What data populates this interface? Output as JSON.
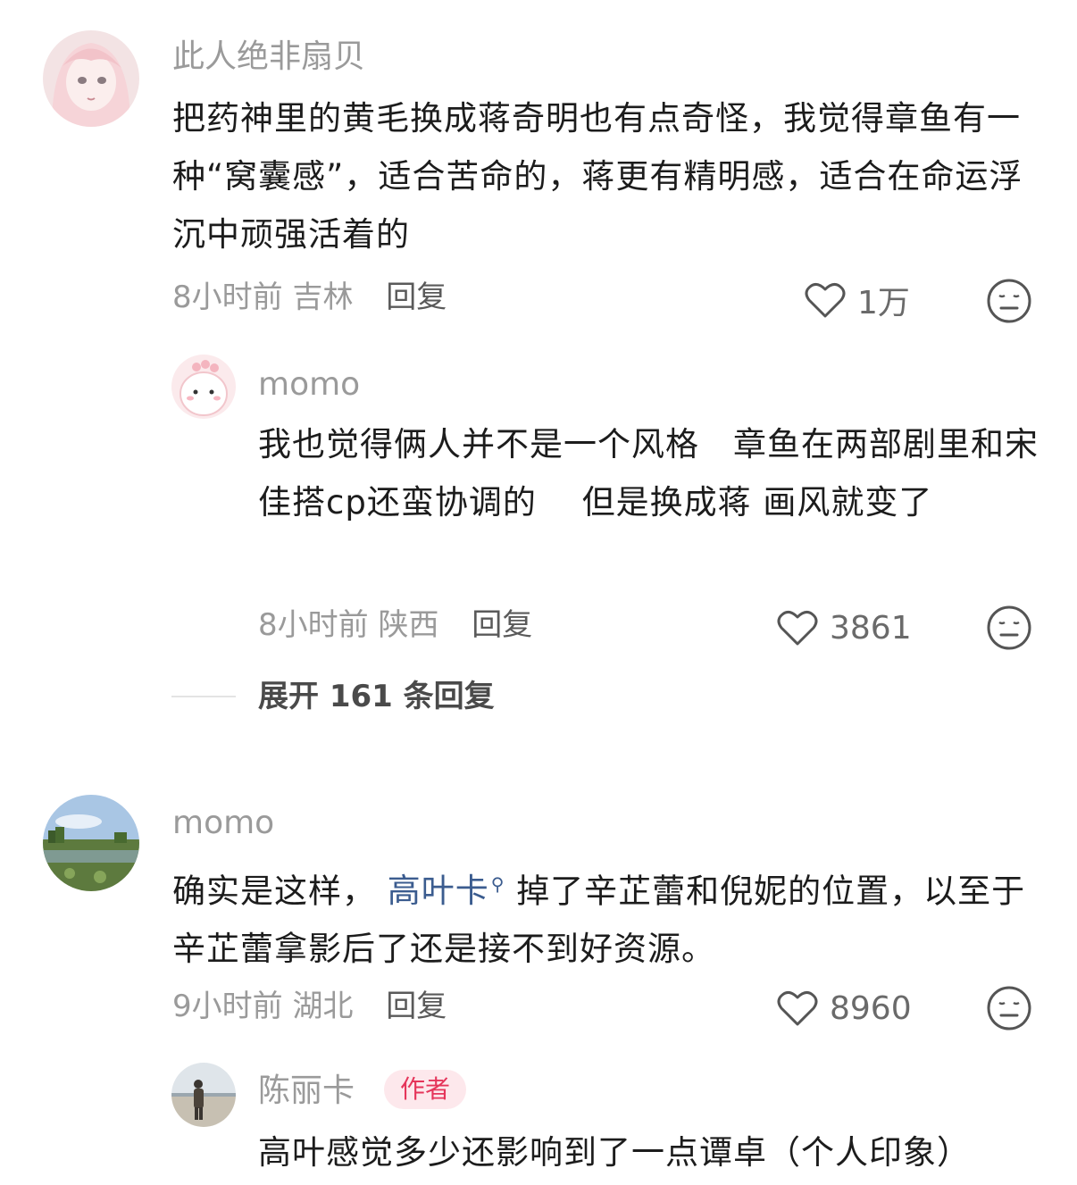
{
  "comments": [
    {
      "username": "此人绝非扇贝",
      "content": "把药神里的黄毛换成蒋奇明也有点奇怪，我觉得章鱼有一种“窝囊感”，适合苦命的，蒋更有精明感，适合在命运浮沉中顽强活着的",
      "time": "8小时前",
      "location": "吉林",
      "reply_label": "回复",
      "likes": "1万",
      "avatar_icon": "anime-girl-avatar",
      "replies": [
        {
          "username": "momo",
          "content": "我也觉得俩人并不是一个风格　章鱼在两部剧里和宋佳搭cp还蛮协调的　 但是换成蒋  画风就变了",
          "time": "8小时前",
          "location": "陕西",
          "reply_label": "回复",
          "likes": "3861",
          "avatar_icon": "pink-dinosaur-avatar"
        }
      ],
      "expand_label": "展开 161 条回复"
    },
    {
      "username": "momo",
      "content_before": "确实是这样，",
      "mention": "高叶卡",
      "content_after": "掉了辛芷蕾和倪妮的位置，以至于辛芷蕾拿影后了还是接不到好资源。",
      "time": "9小时前",
      "location": "湖北",
      "reply_label": "回复",
      "likes": "8960",
      "avatar_icon": "landscape-avatar",
      "replies": [
        {
          "username": "陈丽卡",
          "badge": "作者",
          "content": "高叶感觉多少还影响到了一点谭卓（个人印象）",
          "avatar_icon": "beach-person-avatar"
        }
      ]
    }
  ],
  "colors": {
    "username": "#9a9a9a",
    "mention": "#3b5c8f",
    "author_badge_bg": "#fde8ec",
    "author_badge_text": "#e5355a"
  }
}
